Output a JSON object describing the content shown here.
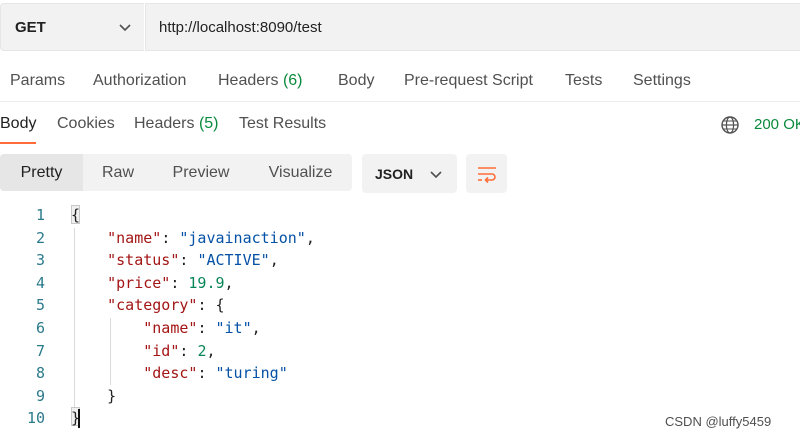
{
  "request": {
    "method": "GET",
    "url": "http://localhost:8090/test"
  },
  "request_tabs": [
    {
      "label": "Params"
    },
    {
      "label": "Authorization"
    },
    {
      "label": "Headers",
      "count": "(6)"
    },
    {
      "label": "Body"
    },
    {
      "label": "Pre-request Script"
    },
    {
      "label": "Tests"
    },
    {
      "label": "Settings"
    }
  ],
  "response_tabs": [
    {
      "label": "Body"
    },
    {
      "label": "Cookies"
    },
    {
      "label": "Headers",
      "count": "(5)"
    },
    {
      "label": "Test Results"
    }
  ],
  "response_status": "200 OK",
  "view_modes": [
    "Pretty",
    "Raw",
    "Preview",
    "Visualize"
  ],
  "format": "JSON",
  "icons": {
    "method_dropdown": "chevron-down-icon",
    "format_dropdown": "chevron-down-icon",
    "network": "globe-icon",
    "wrap": "wrap-lines-icon"
  },
  "colors": {
    "accent": "#ff6c37",
    "success": "#0a8a3c",
    "json_key": "#a31515",
    "json_string": "#0451a5",
    "json_number": "#098658",
    "line_number": "#2b7a8c"
  },
  "code_lines": [
    {
      "n": "1",
      "indent": "",
      "key": "",
      "sep": "",
      "value": "",
      "vtype": "",
      "tail": "{"
    },
    {
      "n": "2",
      "indent": "    ",
      "key": "\"name\"",
      "sep": ": ",
      "value": "\"javainaction\"",
      "vtype": "str",
      "tail": ","
    },
    {
      "n": "3",
      "indent": "    ",
      "key": "\"status\"",
      "sep": ": ",
      "value": "\"ACTIVE\"",
      "vtype": "str",
      "tail": ","
    },
    {
      "n": "4",
      "indent": "    ",
      "key": "\"price\"",
      "sep": ": ",
      "value": "19.9",
      "vtype": "num",
      "tail": ","
    },
    {
      "n": "5",
      "indent": "    ",
      "key": "\"category\"",
      "sep": ": ",
      "value": "",
      "vtype": "",
      "tail": "{"
    },
    {
      "n": "6",
      "indent": "        ",
      "key": "\"name\"",
      "sep": ": ",
      "value": "\"it\"",
      "vtype": "str",
      "tail": ","
    },
    {
      "n": "7",
      "indent": "        ",
      "key": "\"id\"",
      "sep": ": ",
      "value": "2",
      "vtype": "num",
      "tail": ","
    },
    {
      "n": "8",
      "indent": "        ",
      "key": "\"desc\"",
      "sep": ": ",
      "value": "\"turing\"",
      "vtype": "str",
      "tail": ""
    },
    {
      "n": "9",
      "indent": "    ",
      "key": "",
      "sep": "",
      "value": "",
      "vtype": "",
      "tail": "}"
    },
    {
      "n": "10",
      "indent": "",
      "key": "",
      "sep": "",
      "value": "",
      "vtype": "",
      "tail": "}"
    }
  ],
  "watermark": "CSDN @luffy5459"
}
